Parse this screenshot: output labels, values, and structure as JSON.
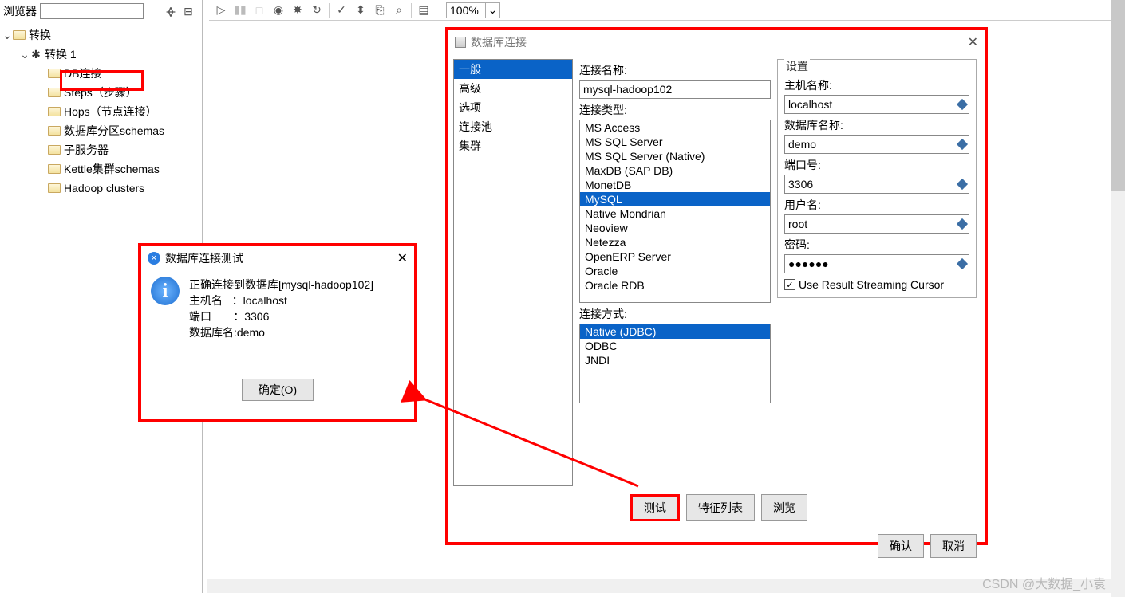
{
  "toolbar": {
    "zoom": "100%"
  },
  "browser": {
    "label": "浏览器",
    "root": "转换",
    "trans1": "转换 1",
    "items": [
      "DB连接",
      "Steps（步骤）",
      "Hops（节点连接）",
      "数据库分区schemas",
      "子服务器",
      "Kettle集群schemas",
      "Hadoop clusters"
    ]
  },
  "test_dialog": {
    "title": "数据库连接测试",
    "line1": "正确连接到数据库[mysql-hadoop102]",
    "line2_label": "主机名",
    "line2_sep": "：",
    "line2_val": "localhost",
    "line3_label": "端口",
    "line3_sep": "：",
    "line3_val": "3306",
    "line4_label": "数据库名:",
    "line4_val": "demo",
    "ok": "确定(O)"
  },
  "conn_dialog": {
    "title": "数据库连接",
    "categories": [
      "一般",
      "高级",
      "选项",
      "连接池",
      "集群"
    ],
    "name_label": "连接名称:",
    "name_value": "mysql-hadoop102",
    "type_label": "连接类型:",
    "types": [
      "MS Access",
      "MS SQL Server",
      "MS SQL Server (Native)",
      "MaxDB (SAP DB)",
      "MonetDB",
      "MySQL",
      "Native Mondrian",
      "Neoview",
      "Netezza",
      "OpenERP Server",
      "Oracle",
      "Oracle RDB"
    ],
    "type_selected": "MySQL",
    "method_label": "连接方式:",
    "methods": [
      "Native (JDBC)",
      "ODBC",
      "JNDI"
    ],
    "method_selected": "Native (JDBC)",
    "settings_label": "设置",
    "host_label": "主机名称:",
    "host_value": "localhost",
    "db_label": "数据库名称:",
    "db_value": "demo",
    "port_label": "端口号:",
    "port_value": "3306",
    "user_label": "用户名:",
    "user_value": "root",
    "pwd_label": "密码:",
    "pwd_value": "●●●●●●",
    "stream_cursor": "Use Result Streaming Cursor",
    "btn_test": "测试",
    "btn_feat": "特征列表",
    "btn_browse": "浏览",
    "btn_ok": "确认",
    "btn_cancel": "取消"
  },
  "watermark": "CSDN @大数据_小袁"
}
